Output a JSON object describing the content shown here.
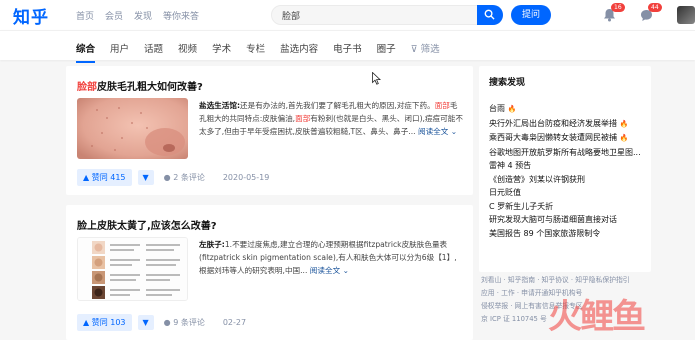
{
  "header": {
    "logo": "知乎",
    "nav": [
      "首页",
      "会员",
      "发现",
      "等你来答"
    ],
    "search_value": "脸部",
    "ask_label": "提问",
    "notifications_badge": "16",
    "messages_badge": "44"
  },
  "tabs": [
    "综合",
    "用户",
    "话题",
    "视频",
    "学术",
    "专栏",
    "盐选内容",
    "电子书",
    "圈子"
  ],
  "filter_label": "筛选",
  "results": [
    {
      "title_highlight": "脸部",
      "title_rest": "皮肤毛孔粗大如何改善?",
      "author": "盐选生活馆:",
      "excerpt_1": "还是有办法的,首先我们要了解毛孔粗大的原因,对症下药。",
      "excerpt_hl1": "面部",
      "excerpt_2": "毛孔粗大的共同特点:皮肤偏油,",
      "excerpt_hl2": "面部",
      "excerpt_3": "有粉刺(也就是白头、黑头、闭口),痘痘可能不太多了,但由于早年受痘困扰,皮肤普遍较粗糙,T区、鼻头、鼻子...",
      "more_label": "阅读全文",
      "vote_label": "赞同 415",
      "comment_label": "2 条评论",
      "date": "2020-05-19"
    },
    {
      "title_highlight": "",
      "title_rest": "脸上皮肤太黄了,应该怎么改善?",
      "author": "左肤子:",
      "excerpt_1": "1.不要过度焦虑,建立合理的心理预期根据fitzpatrick皮肤肤色量表(fitzpatrick skin pigmentation scale),有人和肤色大体可以分为6级【1】,根据刘玮等人的研究表明,中国...",
      "excerpt_hl1": "",
      "excerpt_2": "",
      "excerpt_hl2": "",
      "excerpt_3": "",
      "more_label": "阅读全文",
      "vote_label": "赞同 103",
      "comment_label": "9 条评论",
      "date": "02-27"
    }
  ],
  "sidebar": {
    "title": "搜索发现",
    "items": [
      "台雨",
      "央行外汇局出台防疫和经济发展举措",
      "乘西哥大毒枭因懒转女装遭网民被捕",
      "谷歌地图开放航罗斯所有战略要地卫星图...",
      "雷神 4 预告",
      "《创造营》刘某以许钢获刑",
      "日元贬值",
      "C 罗新生儿子夭折",
      "研究发现大脑可与肠道细菌直接对话",
      "美国报告 89 个国家旅游限制令"
    ]
  },
  "footer": {
    "line1": "刘看山 · 知乎指南 · 知乎协议 · 知乎隐私保护指引",
    "line2": "应用 · 工作 · 申请开通知乎机构号",
    "line3": "侵权举报 · 网上有害信息举报专区",
    "line4": "京 ICP 证 110745 号"
  }
}
